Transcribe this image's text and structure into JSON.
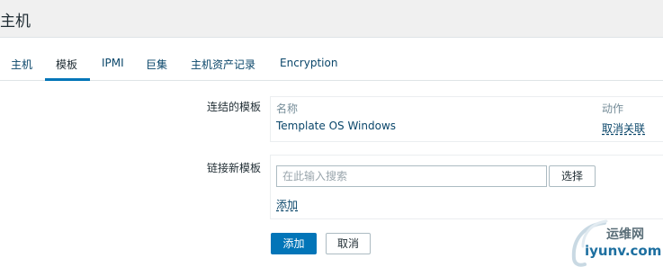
{
  "header": {
    "title": "主机"
  },
  "tabs": [
    {
      "label": "主机"
    },
    {
      "label": "模板"
    },
    {
      "label": "IPMI"
    },
    {
      "label": "巨集"
    },
    {
      "label": "主机资产记录"
    },
    {
      "label": "Encryption"
    }
  ],
  "linked_templates": {
    "label": "连结的模板",
    "col_name": "名称",
    "col_action": "动作",
    "rows": [
      {
        "name": "Template OS Windows",
        "action": "取消关联"
      }
    ]
  },
  "link_new_templates": {
    "label": "链接新模板",
    "search_placeholder": "在此输入搜索",
    "select_label": "选择",
    "add_label": "添加"
  },
  "form_buttons": {
    "add_label": "添加",
    "cancel_label": "取消"
  },
  "watermark": {
    "top_text": "运维网",
    "bottom_text": "iyunv.com"
  },
  "colors": {
    "accent": "#0275b8",
    "link": "#0a466a",
    "header_bg": "#f0f0f0"
  }
}
